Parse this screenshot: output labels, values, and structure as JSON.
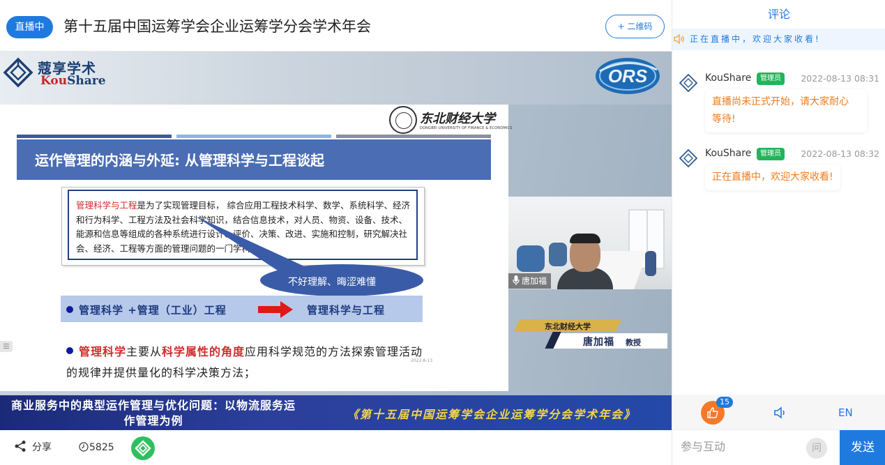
{
  "header": {
    "live_badge": "直播中",
    "title": "第十五届中国运筹学会企业运筹学分会学术年会",
    "qr_button": "+ 二维码"
  },
  "video": {
    "logo_cn": "蔻享学术",
    "logo_en_k": "Kou",
    "logo_en_s": "Share",
    "ors_logo": "ORS",
    "slide": {
      "university_cn": "东北财经大学",
      "university_en": "DONGBEI UNIVERSITY OF FINANCE & ECONOMICS",
      "heading": "运作管理的内涵与外延: 从管理科学与工程谈起",
      "definition_term": "管理科学与工程",
      "definition_rest": "是为了实现管理目标， 综合应用工程技术科学、数学、系统科学、经济和行为科学、工程方法及社会科学知识，结合信息技术，对人员、物资、设备、技术、能源和信息等组成的各种系统进行设计、评价、决策、改进、实施和控制，研究解决社会、经济、工程等方面的管理问题的一门学科。",
      "callout": "不好理解、晦涩难懂",
      "formula_left": "管理科学 +管理（工业）工程",
      "formula_right": "管理科学与工程",
      "desc_term1": "管理科学",
      "desc_mid1": "主要从",
      "desc_term2": "科学属性的角度",
      "desc_rest": "应用科学规范的方法探索管理活动的规律并提供量化的科学决策方法；",
      "date": "2022-8-13"
    },
    "camera_name": "唐加福",
    "nameplate": {
      "org": "东北财经大学",
      "name": "唐加福",
      "title": "教授"
    },
    "banner": {
      "talk_title": "商业服务中的典型运作管理与优化问题：以物流服务运作管理为例",
      "conference": "《第十五届中国运筹学会企业运筹学分会学术年会》"
    }
  },
  "footer": {
    "share_label": "分享",
    "views": "5825"
  },
  "panel": {
    "tab": "评论",
    "notice": "正在直播中，欢迎大家收看!",
    "messages": [
      {
        "user": "KouShare",
        "role": "管理员",
        "time": "2022-08-13 08:31",
        "text_line1": "直播尚未正式开始，请大家耐心",
        "text_line2": "等待!"
      },
      {
        "user": "KouShare",
        "role": "管理员",
        "time": "2022-08-13 08:32",
        "text_line1": "正在直播中，欢迎大家收看!"
      }
    ],
    "like_count": "15",
    "lang": "EN",
    "input_placeholder": "参与互动",
    "ask_label": "问",
    "send_label": "发送"
  },
  "colors": {
    "accent": "#1f7ae0",
    "admin_badge": "#23b45a",
    "message_text": "#f27a1b",
    "like": "#f47a2a"
  }
}
